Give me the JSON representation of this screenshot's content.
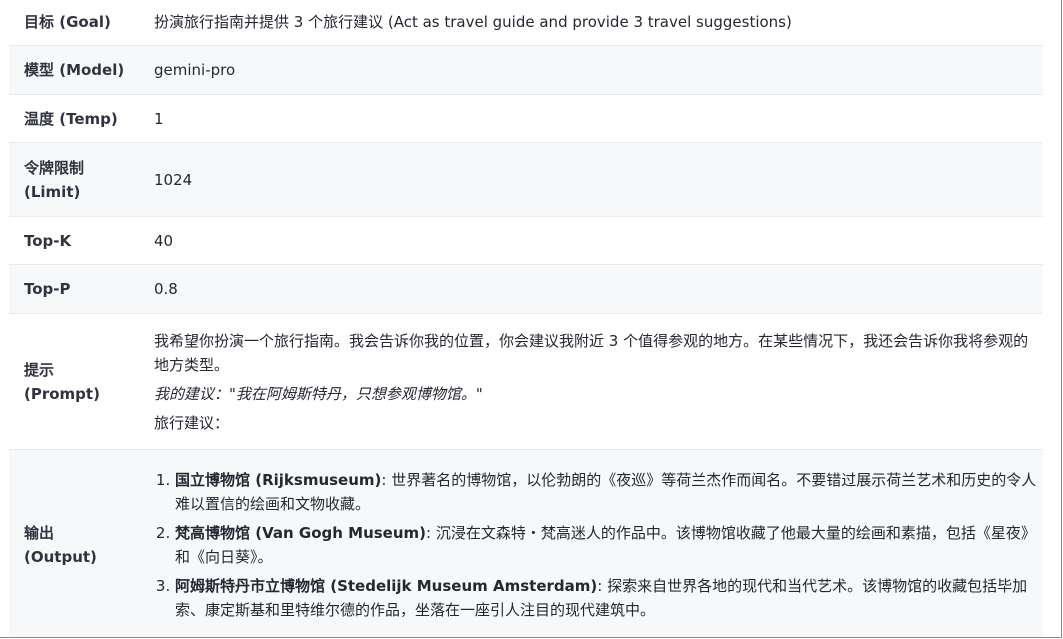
{
  "rows": {
    "goal": {
      "label": "目标 (Goal)",
      "value": "扮演旅行指南并提供 3 个旅行建议 (Act as travel guide and provide 3 travel suggestions)"
    },
    "model": {
      "label": "模型 (Model)",
      "value": "gemini-pro"
    },
    "temp": {
      "label": "温度 (Temp)",
      "value": "1"
    },
    "limit": {
      "label_line1": "令牌限制",
      "label_line2": "(Limit)",
      "value": "1024"
    },
    "topk": {
      "label": "Top-K",
      "value": "40"
    },
    "topp": {
      "label": "Top-P",
      "value": "0.8"
    },
    "prompt": {
      "label_line1": "提示",
      "label_line2": "(Prompt)",
      "text1": "我希望你扮演一个旅行指南。我会告诉你我的位置，你会建议我附近 3 个值得参观的地方。在某些情况下，我还会告诉你我将参观的地方类型。",
      "text2": "我的建议：\"我在阿姆斯特丹，只想参观博物馆。\"",
      "text3": "旅行建议："
    },
    "output": {
      "label_line1": "输出",
      "label_line2": "(Output)",
      "items": [
        {
          "title": "国立博物馆 (Rijksmuseum)",
          "text": ": 世界著名的博物馆，以伦勃朗的《夜巡》等荷兰杰作而闻名。不要错过展示荷兰艺术和历史的令人难以置信的绘画和文物收藏。"
        },
        {
          "title": "梵高博物馆 (Van Gogh Museum)",
          "text": ": 沉浸在文森特・梵高迷人的作品中。该博物馆收藏了他最大量的绘画和素描，包括《星夜》和《向日葵》。"
        },
        {
          "title": "阿姆斯特丹市立博物馆 (Stedelijk Museum Amsterdam)",
          "text": ": 探索来自世界各地的现代和当代艺术。该博物馆的收藏包括毕加索、康定斯基和里特维尔德的作品，坐落在一座引人注目的现代建筑中。"
        }
      ]
    }
  }
}
